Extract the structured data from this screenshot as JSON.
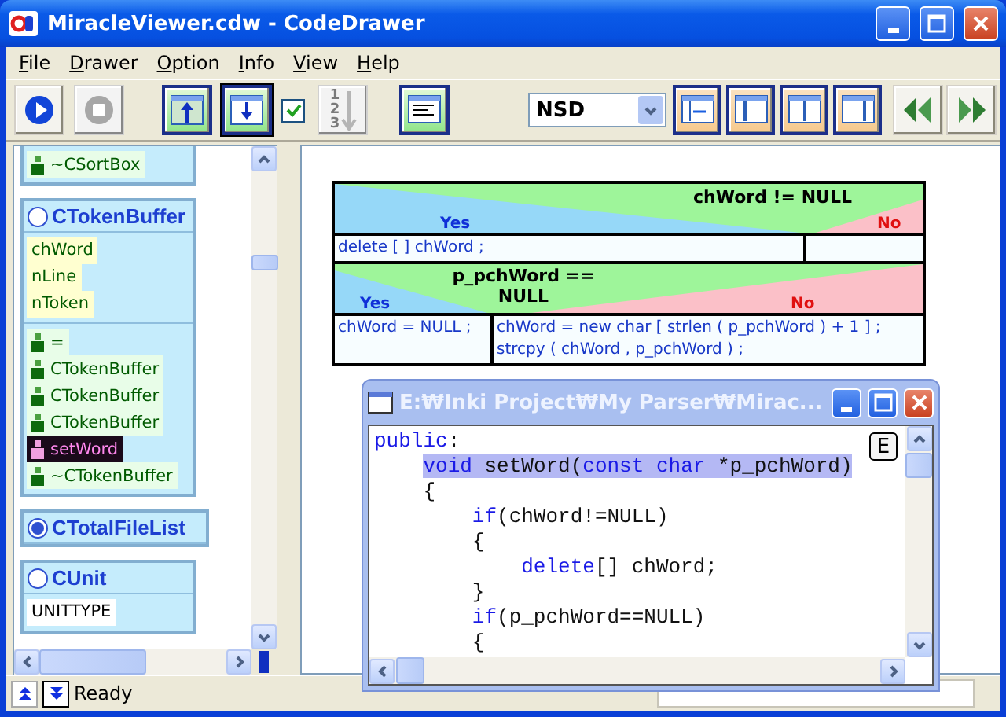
{
  "window": {
    "title": "MiracleViewer.cdw - CodeDrawer"
  },
  "menu": [
    {
      "label": "File"
    },
    {
      "label": "Drawer"
    },
    {
      "label": "Option"
    },
    {
      "label": "Info"
    },
    {
      "label": "View"
    },
    {
      "label": "Help"
    }
  ],
  "toolbar": {
    "buttons": [
      {
        "kind": "run",
        "disabled": false,
        "pressed": false
      },
      {
        "kind": "stop",
        "disabled": true,
        "pressed": false
      },
      {
        "kind": "move-up",
        "disabled": false,
        "pressed": false
      },
      {
        "kind": "move-down",
        "disabled": false,
        "pressed": true
      },
      {
        "kind": "check",
        "checked": true
      },
      {
        "kind": "numbering",
        "label": "123",
        "disabled": true,
        "pressed": false
      },
      {
        "kind": "source",
        "disabled": false,
        "pressed": false
      }
    ],
    "view": "NSD",
    "layout_buttons": [
      {
        "kind": "fit-width"
      },
      {
        "kind": "left-pane"
      },
      {
        "kind": "center-pane"
      },
      {
        "kind": "right-pane"
      }
    ],
    "nav_buttons": [
      {
        "kind": "back"
      },
      {
        "kind": "forward"
      }
    ]
  },
  "tree": {
    "classes": [
      {
        "expanded": true,
        "methods": [
          {
            "name": "~CSortBox",
            "selected": false
          }
        ]
      },
      {
        "name": "CTokenBuffer",
        "expanded": true,
        "attributes": [
          {
            "name": "chWord",
            "kind": "variable"
          },
          {
            "name": "nLine",
            "kind": "variable"
          },
          {
            "name": "nToken",
            "kind": "variable"
          }
        ],
        "methods": [
          {
            "name": "=",
            "selected": false
          },
          {
            "name": "CTokenBuffer",
            "selected": false
          },
          {
            "name": "CTokenBuffer",
            "selected": false
          },
          {
            "name": "CTokenBuffer",
            "selected": false
          },
          {
            "name": "setWord",
            "selected": true
          },
          {
            "name": "~CTokenBuffer",
            "selected": false
          }
        ]
      },
      {
        "name": "CTotalFileList",
        "expanded": false
      },
      {
        "name": "CUnit",
        "expanded": true,
        "attributes": [
          {
            "name": "UNITTYPE",
            "kind": "type"
          }
        ]
      }
    ]
  },
  "nsd": {
    "blocks": [
      {
        "kind": "if",
        "condition": "chWord != NULL",
        "yes_label": "Yes",
        "no_label": "No",
        "yes": [
          "delete [ ] chWord ;"
        ]
      },
      {
        "kind": "if",
        "condition": "p_pchWord == NULL",
        "yes_label": "Yes",
        "no_label": "No",
        "yes": [
          "chWord = NULL ;"
        ],
        "no": [
          "chWord = new char [ strlen ( p_pchWord ) + 1 ] ;",
          "strcpy ( chWord , p_pchWord ) ;"
        ]
      }
    ]
  },
  "code_window": {
    "title": "E:₩Inki Project₩My Parser₩Mirac...",
    "editor_button": "E",
    "lines": [
      {
        "highlighted": false,
        "tokens": [
          {
            "kind": "keyword",
            "text": "public"
          },
          {
            "kind": "plain",
            "text": ":"
          }
        ]
      },
      {
        "highlighted": true,
        "tokens": [
          {
            "kind": "keyword",
            "text": "    void"
          },
          {
            "kind": "plain",
            "text": " setWord("
          },
          {
            "kind": "keyword",
            "text": "const char"
          },
          {
            "kind": "plain",
            "text": " *p_pchWord)"
          }
        ]
      },
      {
        "highlighted": false,
        "tokens": [
          {
            "kind": "plain",
            "text": "    {"
          }
        ]
      },
      {
        "highlighted": false,
        "tokens": [
          {
            "kind": "keyword",
            "text": "        if"
          },
          {
            "kind": "plain",
            "text": "(chWord!=NULL)"
          }
        ]
      },
      {
        "highlighted": false,
        "tokens": [
          {
            "kind": "plain",
            "text": "        {"
          }
        ]
      },
      {
        "highlighted": false,
        "tokens": [
          {
            "kind": "keyword",
            "text": "            delete"
          },
          {
            "kind": "plain",
            "text": "[] chWord;"
          }
        ]
      },
      {
        "highlighted": false,
        "tokens": [
          {
            "kind": "plain",
            "text": "        }"
          }
        ]
      },
      {
        "highlighted": false,
        "tokens": [
          {
            "kind": "keyword",
            "text": "        if"
          },
          {
            "kind": "plain",
            "text": "(p_pchWord==NULL)"
          }
        ]
      },
      {
        "highlighted": false,
        "tokens": [
          {
            "kind": "plain",
            "text": "        {"
          }
        ]
      }
    ]
  },
  "status_bar": {
    "text": "Ready"
  }
}
